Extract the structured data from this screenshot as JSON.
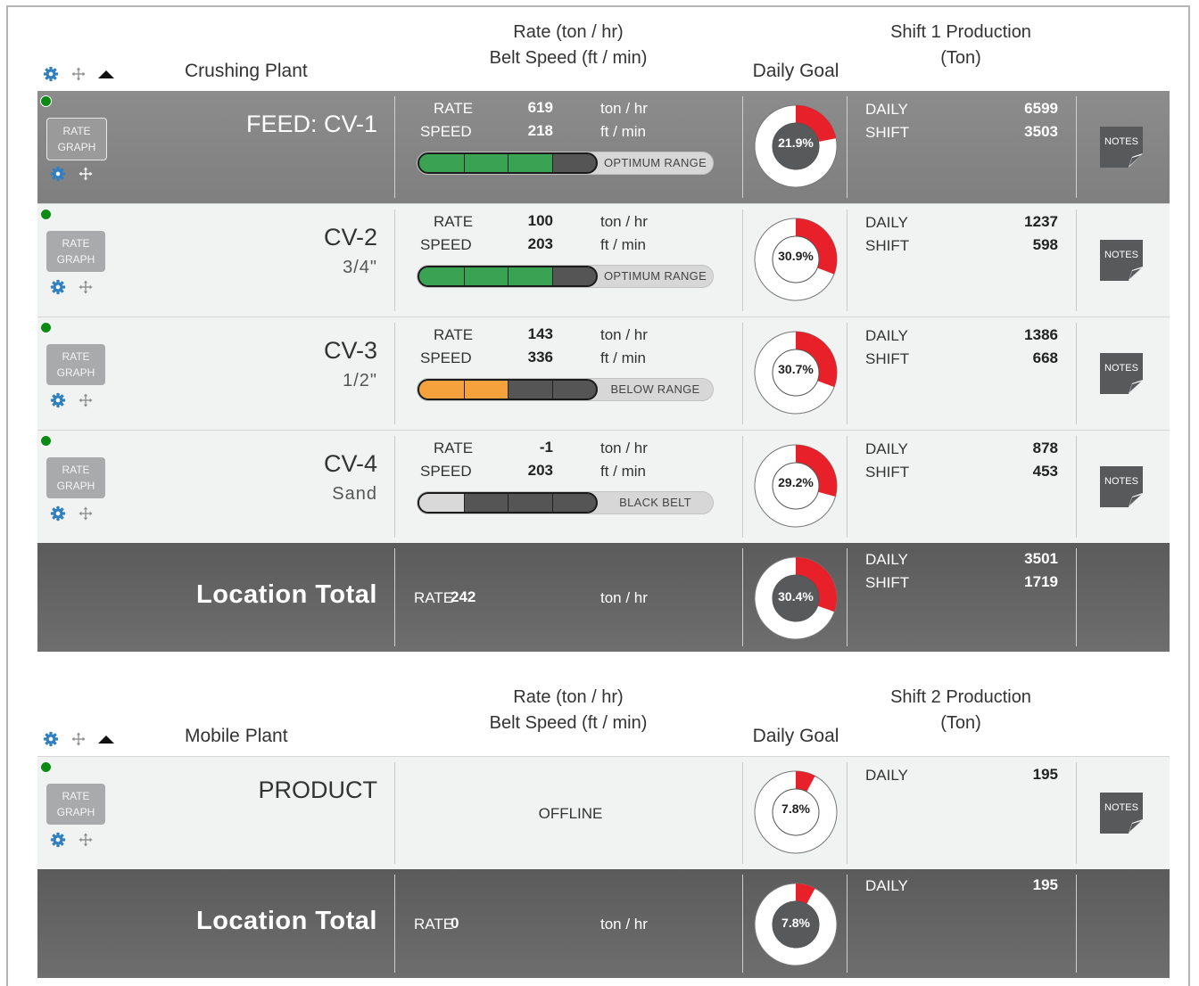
{
  "plants": [
    {
      "name": "Crushing Plant",
      "header": {
        "rate_line1": "Rate (ton / hr)",
        "rate_line2": "Belt Speed (ft / min)",
        "goal": "Daily Goal",
        "prod_line1": "Shift 1 Production",
        "prod_line2": "(Ton)"
      },
      "rows": [
        {
          "name": "FEED: CV-1",
          "sub": "",
          "rate": "619",
          "speed": "218",
          "bar_status": "OPTIMUM RANGE",
          "fill_fraction": 0.75,
          "fill_color": "#3aa353",
          "goal_pct": "21.9%",
          "goal_fraction": 0.219,
          "daily": "6599",
          "shift": "3503",
          "dark": true
        },
        {
          "name": "CV-2",
          "sub": "3/4\"",
          "rate": "100",
          "speed": "203",
          "bar_status": "OPTIMUM RANGE",
          "fill_fraction": 0.75,
          "fill_color": "#3aa353",
          "goal_pct": "30.9%",
          "goal_fraction": 0.309,
          "daily": "1237",
          "shift": "598",
          "dark": false
        },
        {
          "name": "CV-3",
          "sub": "1/2\"",
          "rate": "143",
          "speed": "336",
          "bar_status": "BELOW RANGE",
          "fill_fraction": 0.5,
          "fill_color": "#f5a13c",
          "goal_pct": "30.7%",
          "goal_fraction": 0.307,
          "daily": "1386",
          "shift": "668",
          "dark": false
        },
        {
          "name": "CV-4",
          "sub": "Sand",
          "rate": "-1",
          "speed": "203",
          "bar_status": "BLACK BELT",
          "fill_fraction": 0.25,
          "fill_color": "#d9d9d9",
          "goal_pct": "29.2%",
          "goal_fraction": 0.292,
          "daily": "878",
          "shift": "453",
          "dark": false
        }
      ],
      "total": {
        "name": "Location Total",
        "rate": "242",
        "goal_pct": "30.4%",
        "goal_fraction": 0.304,
        "daily": "3501",
        "shift": "1719"
      }
    },
    {
      "name": "Mobile Plant",
      "header": {
        "rate_line1": "Rate (ton / hr)",
        "rate_line2": "Belt Speed (ft / min)",
        "goal": "Daily Goal",
        "prod_line1": "Shift 2 Production",
        "prod_line2": "(Ton)"
      },
      "rows": [
        {
          "name": "PRODUCT",
          "sub": "",
          "offline": "OFFLINE",
          "goal_pct": "7.8%",
          "goal_fraction": 0.078,
          "daily": "195",
          "dark": false
        }
      ],
      "total": {
        "name": "Location Total",
        "rate": "0",
        "goal_pct": "7.8%",
        "goal_fraction": 0.078,
        "daily": "195"
      }
    }
  ],
  "labels": {
    "rate": "RATE",
    "speed": "SPEED",
    "rate_unit": "ton / hr",
    "speed_unit": "ft / min",
    "daily": "DAILY",
    "shift": "SHIFT",
    "rate_btn_line1": "RATE",
    "rate_btn_line2": "GRAPH",
    "notes": "NOTES"
  },
  "icons": {
    "settings": "gear-icon",
    "move": "move-icon",
    "collapse": "caret-up-icon",
    "status": "status-dot-icon"
  },
  "colors": {
    "accent_blue": "#2f7fc1",
    "goal_red": "#e8202a",
    "status_green": "#0b8a14",
    "optimum": "#3aa353",
    "below": "#f5a13c"
  }
}
